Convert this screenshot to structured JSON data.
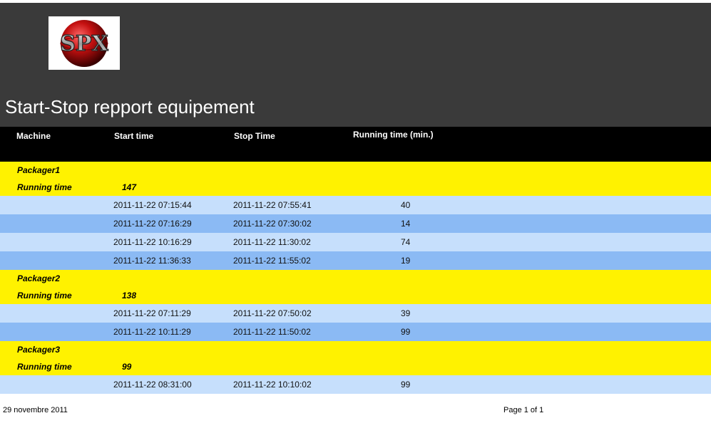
{
  "report": {
    "logo_text": "SPX",
    "title": "Start-Stop repport equipement"
  },
  "columns": {
    "machine": "Machine",
    "start": "Start time",
    "stop": "Stop Time",
    "running": "Running time (min.)"
  },
  "groups": [
    {
      "machine": "Packager1",
      "total_label": "Running time",
      "total": "147",
      "rows": [
        {
          "start": "2011-11-22 07:15:44",
          "stop": "2011-11-22 07:55:41",
          "minutes": "40"
        },
        {
          "start": "2011-11-22 07:16:29",
          "stop": "2011-11-22 07:30:02",
          "minutes": "14"
        },
        {
          "start": "2011-11-22 10:16:29",
          "stop": "2011-11-22 11:30:02",
          "minutes": "74"
        },
        {
          "start": "2011-11-22 11:36:33",
          "stop": "2011-11-22 11:55:02",
          "minutes": "19"
        }
      ]
    },
    {
      "machine": "Packager2",
      "total_label": "Running time",
      "total": "138",
      "rows": [
        {
          "start": "2011-11-22 07:11:29",
          "stop": "2011-11-22 07:50:02",
          "minutes": "39"
        },
        {
          "start": "2011-11-22 10:11:29",
          "stop": "2011-11-22 11:50:02",
          "minutes": "99"
        }
      ]
    },
    {
      "machine": "Packager3",
      "total_label": "Running time",
      "total": "99",
      "rows": [
        {
          "start": "2011-11-22 08:31:00",
          "stop": "2011-11-22 10:10:02",
          "minutes": "99"
        }
      ]
    }
  ],
  "footer": {
    "date": "29 novembre 2011",
    "page": "Page 1 of 1"
  },
  "colors": {
    "header_bg": "#3a3a3a",
    "column_header_bg": "#000000",
    "group_bg": "#fff200",
    "row_light": "#c6dffc",
    "row_dark": "#8bbaf4"
  }
}
